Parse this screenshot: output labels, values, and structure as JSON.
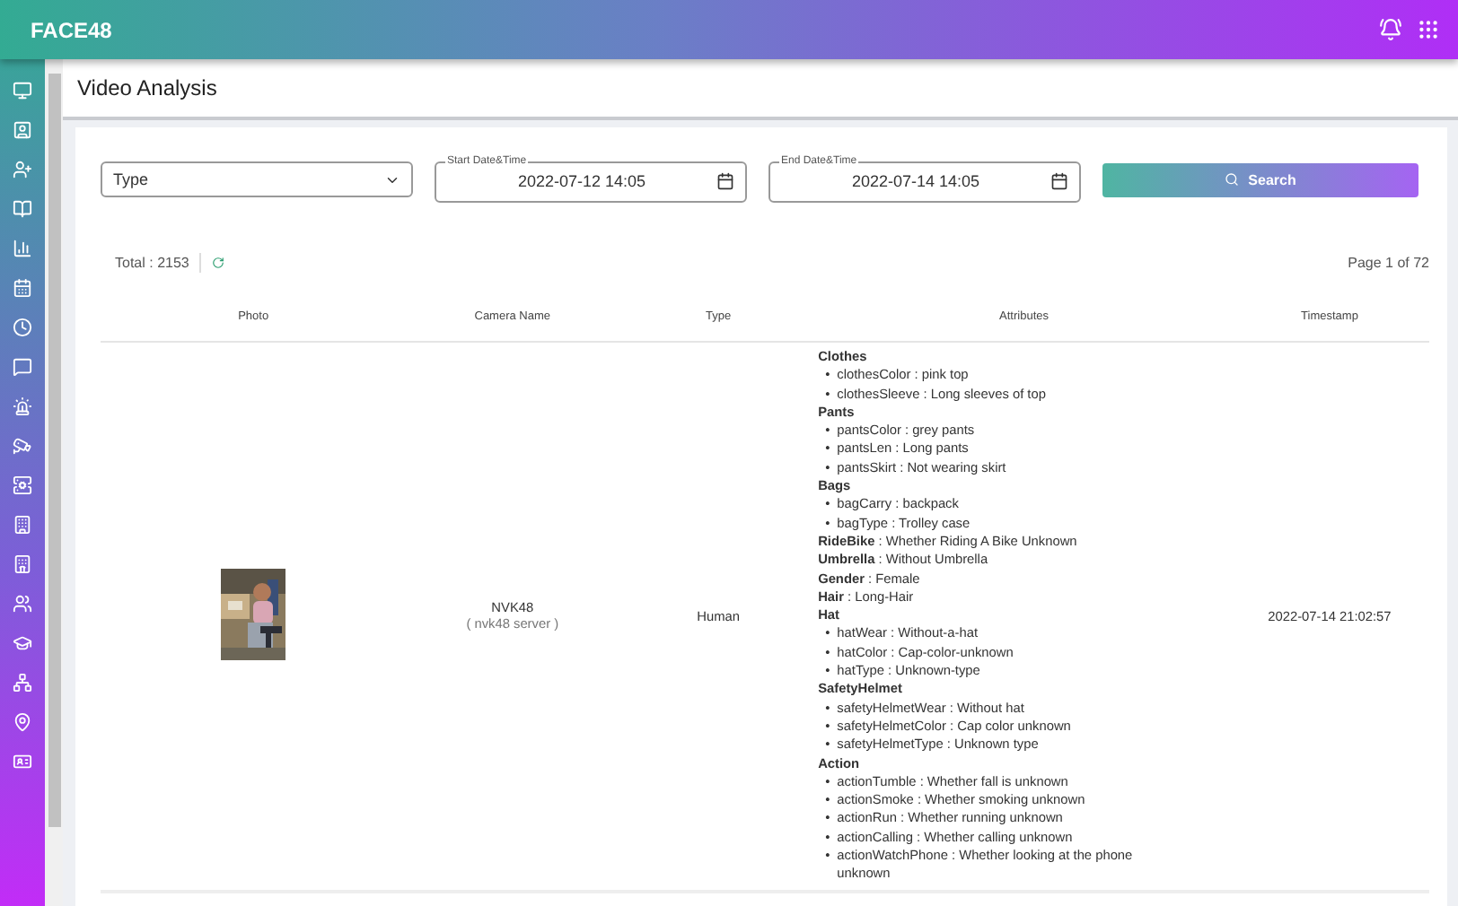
{
  "app": {
    "name": "FACE48"
  },
  "page": {
    "title": "Video Analysis"
  },
  "filters": {
    "type": {
      "placeholder": "Type"
    },
    "start": {
      "label": "Start Date&Time",
      "value": "2022-07-12 14:05"
    },
    "end": {
      "label": "End Date&Time",
      "value": "2022-07-14 14:05"
    },
    "search_button": "Search"
  },
  "summary": {
    "total": "Total : 2153",
    "page": "Page 1 of 72"
  },
  "table": {
    "columns": [
      "Photo",
      "Camera Name",
      "Type",
      "Attributes",
      "Timestamp"
    ],
    "rows": [
      {
        "camera": "NVK48",
        "server": "( nvk48 server )",
        "type": "Human",
        "timestamp": "2022-07-14 21:02:57",
        "attributes": [
          {
            "kind": "group",
            "label": "Clothes",
            "bullet": "•",
            "items": [
              "clothesColor : pink top",
              "clothesSleeve : Long sleeves of top"
            ]
          },
          {
            "kind": "group",
            "label": "Pants",
            "bullet": "•",
            "items": [
              "pantsColor : grey pants",
              "pantsLen : Long pants",
              "pantsSkirt : Not wearing skirt"
            ]
          },
          {
            "kind": "group",
            "label": "Bags",
            "bullet": "•",
            "items": [
              "bagCarry : backpack",
              "bagType : Trolley case"
            ]
          },
          {
            "kind": "pair",
            "text": "**RideBike** : Whether Riding A Bike Unknown"
          },
          {
            "kind": "pair",
            "text": "**Umbrella** : Without Umbrella"
          },
          {
            "kind": "pair",
            "text": "**Gender** : Female"
          },
          {
            "kind": "pair",
            "text": "**Hair** : Long-Hair"
          },
          {
            "kind": "group",
            "label": "Hat",
            "bullet": "•",
            "items": [
              "hatWear : Without-a-hat",
              "hatColor : Cap-color-unknown",
              "hatType : Unknown-type"
            ]
          },
          {
            "kind": "group",
            "label": "SafetyHelmet",
            "bullet": "•",
            "items": [
              "safetyHelmetWear : Without hat",
              "safetyHelmetColor : Cap color unknown",
              "safetyHelmetType : Unknown type"
            ]
          },
          {
            "kind": "group",
            "label": "Action",
            "bullet": "•",
            "items": [
              "actionTumble : Whether fall is unknown",
              "actionSmoke : Whether smoking unknown",
              "actionRun : Whether running unknown",
              "actionCalling : Whether calling unknown",
              "actionWatchPhone : Whether looking at the phone unknown"
            ]
          }
        ]
      }
    ]
  }
}
